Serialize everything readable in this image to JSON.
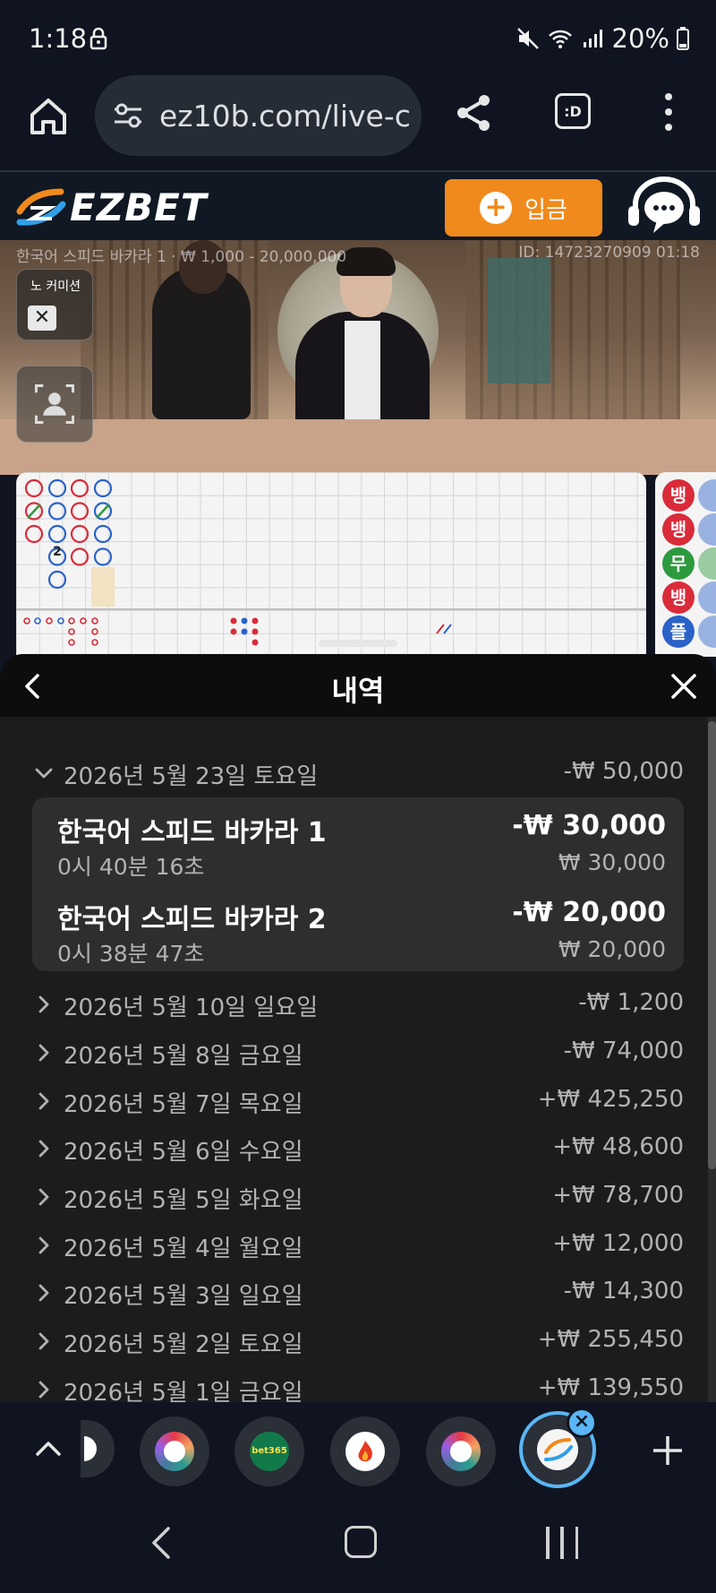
{
  "status_bar": {
    "time": "1:18",
    "battery": "20%"
  },
  "browser": {
    "url": "ez10b.com/live-c",
    "tabs_label": ":D"
  },
  "site": {
    "logo_text": "EZBET",
    "deposit_label": "입금",
    "colors": {
      "accent": "#f08a1c",
      "header_bg": "#101823"
    }
  },
  "video": {
    "info_left": "한국어 스피드 바카라 1 · ₩ 1,000 - 20,000,000",
    "info_right": "ID: 14723270909 01:18",
    "no_commission_label": "노 커미션",
    "no_commission_value": "✕"
  },
  "side_road": [
    {
      "label": "뱅",
      "color": "#d92b3a"
    },
    {
      "label": "뱅",
      "color": "#d92b3a"
    },
    {
      "label": "무",
      "color": "#2e9a3e"
    },
    {
      "label": "뱅",
      "color": "#d92b3a"
    },
    {
      "label": "플",
      "color": "#2a62c9"
    }
  ],
  "road_tie_number": "2",
  "history": {
    "title": "내역",
    "expanded_day": {
      "date": "2026년 5월 23일 토요일",
      "amount": "-₩ 50,000",
      "games": [
        {
          "name": "한국어 스피드 바카라 1",
          "time": "0시 40분 16초",
          "result": "-₩ 30,000",
          "bet": "₩ 30,000"
        },
        {
          "name": "한국어 스피드 바카라 2",
          "time": "0시 38분 47초",
          "result": "-₩ 20,000",
          "bet": "₩ 20,000"
        }
      ]
    },
    "days": [
      {
        "date": "2026년 5월 10일 일요일",
        "amount": "-₩ 1,200"
      },
      {
        "date": "2026년 5월 8일 금요일",
        "amount": "-₩ 74,000"
      },
      {
        "date": "2026년 5월 7일 목요일",
        "amount": "+₩ 425,250"
      },
      {
        "date": "2026년 5월 6일 수요일",
        "amount": "+₩ 48,600"
      },
      {
        "date": "2026년 5월 5일 화요일",
        "amount": "+₩ 78,700"
      },
      {
        "date": "2026년 5월 4일 월요일",
        "amount": "+₩ 12,000"
      },
      {
        "date": "2026년 5월 3일 일요일",
        "amount": "-₩ 14,300"
      },
      {
        "date": "2026년 5월 2일 토요일",
        "amount": "+₩ 255,450"
      },
      {
        "date": "2026년 5월 1일 금요일",
        "amount": "+₩ 139,550"
      }
    ]
  },
  "tab_strip": {
    "tabs": [
      {
        "icon": "rainbow-app-icon"
      },
      {
        "icon": "bet365-icon",
        "label": "bet365"
      },
      {
        "icon": "flame-icon"
      },
      {
        "icon": "rainbow-app-icon"
      }
    ],
    "active_tab_icon": "ezbet-icon"
  }
}
